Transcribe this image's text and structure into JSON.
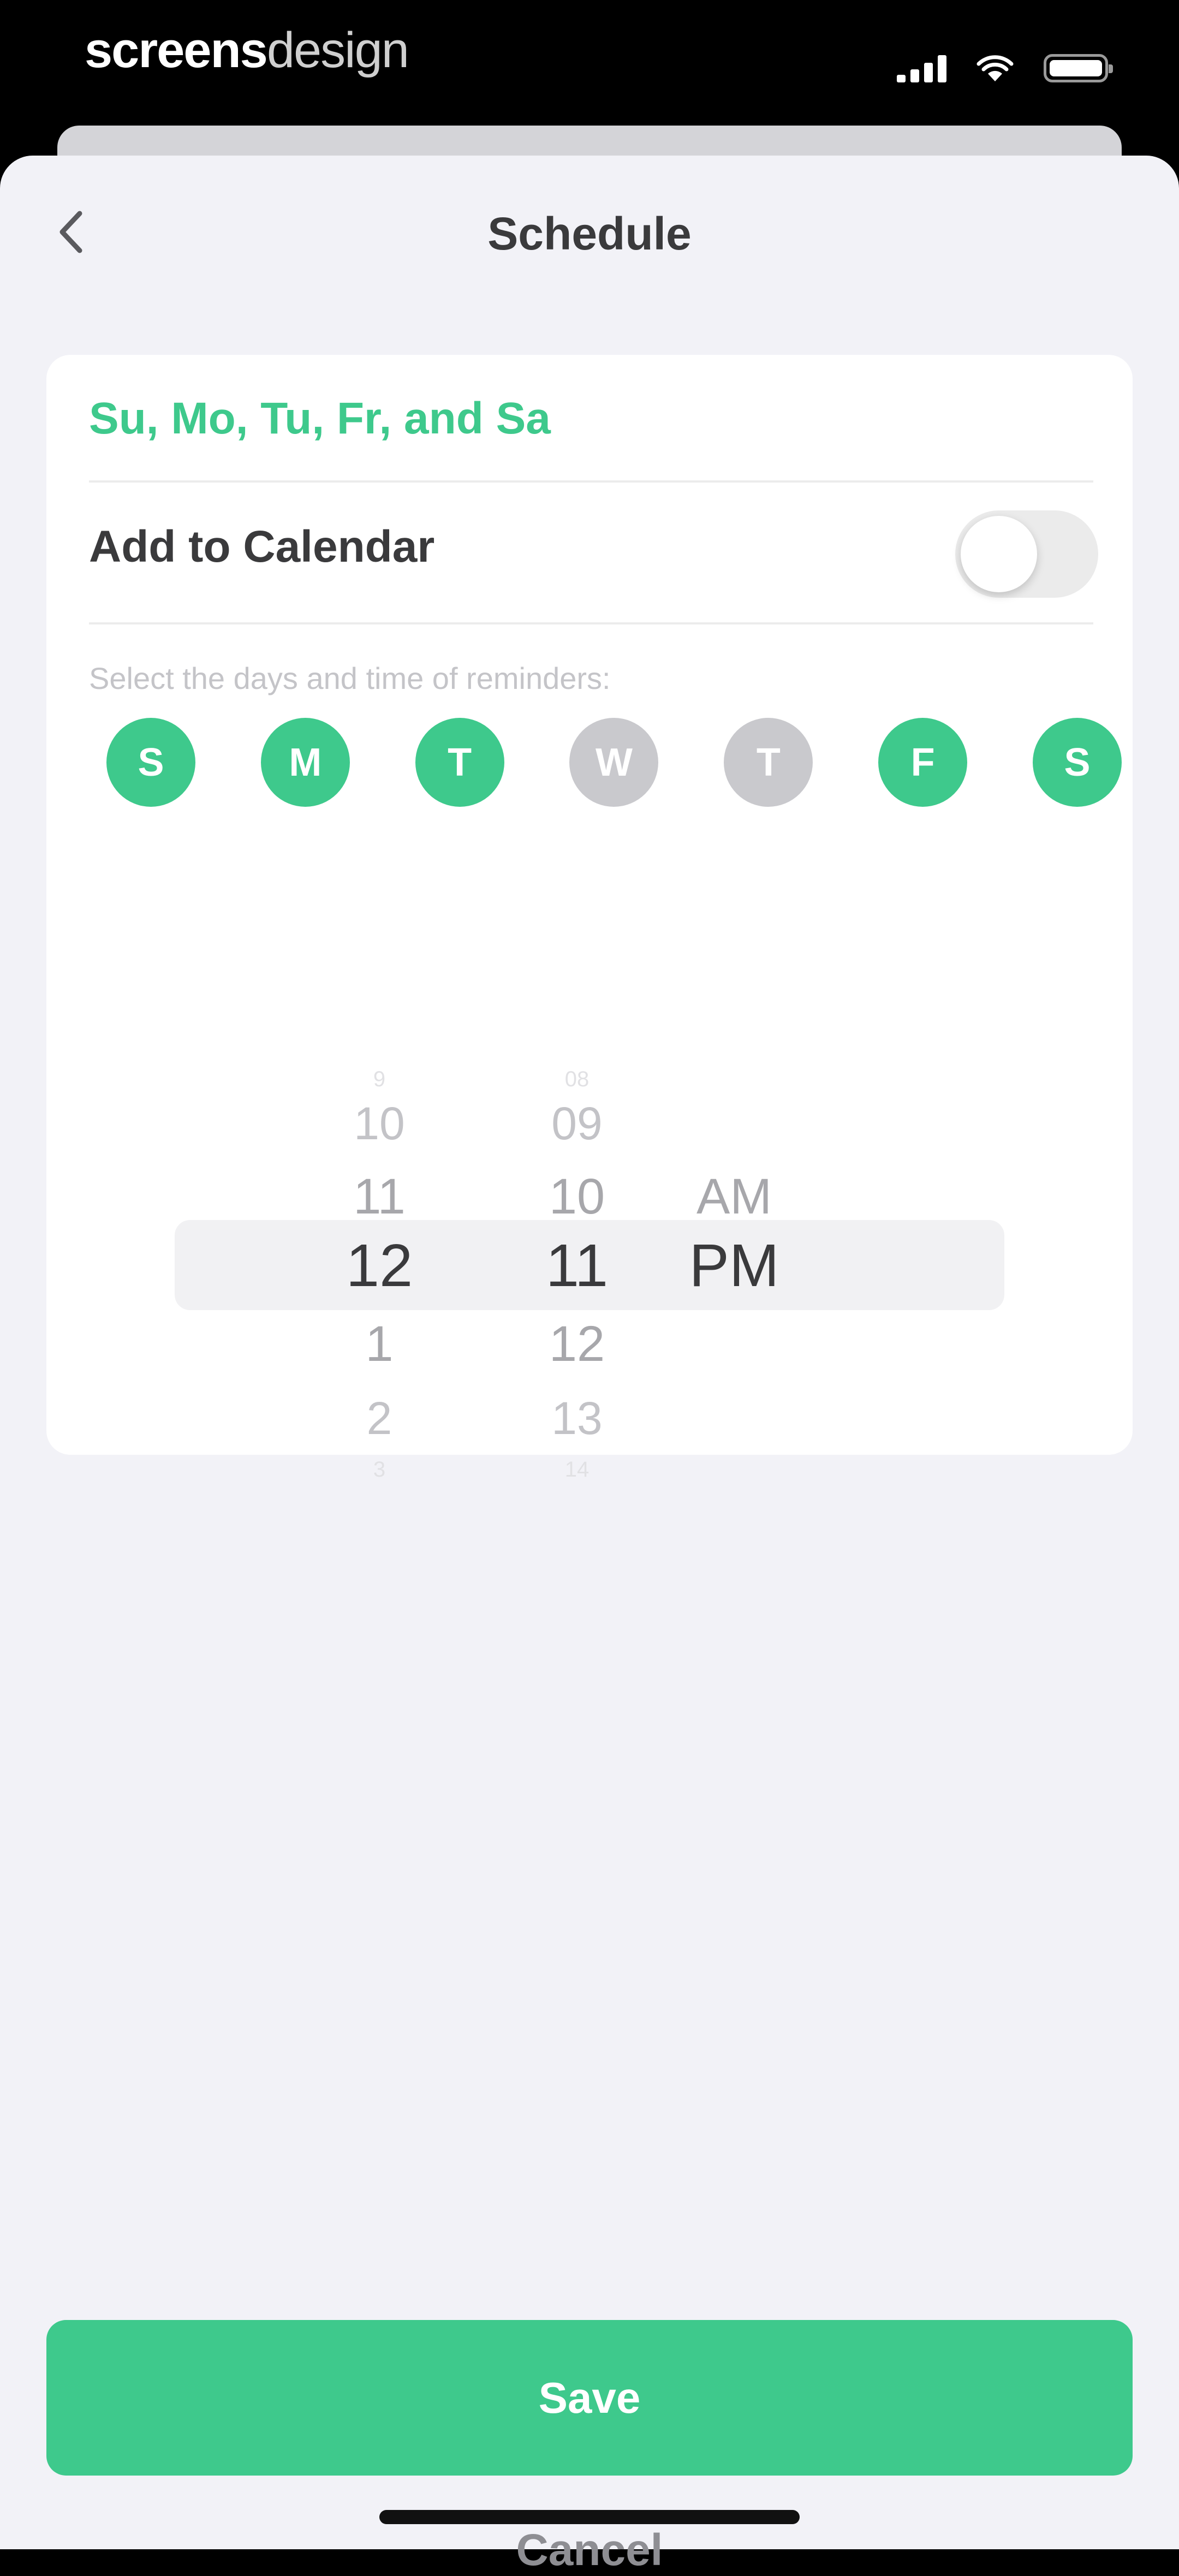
{
  "status_bar": {
    "brand_bold": "screens",
    "brand_light": "design"
  },
  "header": {
    "title": "Schedule"
  },
  "schedule": {
    "days_summary": "Su, Mo, Tu, Fr, and Sa",
    "add_to_calendar_label": "Add to Calendar",
    "add_to_calendar_enabled": false,
    "reminder_hint": "Select the days and time of reminders:",
    "days": [
      {
        "label": "S",
        "selected": true
      },
      {
        "label": "M",
        "selected": true
      },
      {
        "label": "T",
        "selected": true
      },
      {
        "label": "W",
        "selected": false
      },
      {
        "label": "T",
        "selected": false
      },
      {
        "label": "F",
        "selected": true
      },
      {
        "label": "S",
        "selected": true
      }
    ]
  },
  "time_picker": {
    "hours": [
      "9",
      "10",
      "11",
      "12",
      "1",
      "2",
      "3"
    ],
    "minutes": [
      "08",
      "09",
      "10",
      "11",
      "12",
      "13",
      "14"
    ],
    "periods": [
      "AM",
      "PM"
    ],
    "selected_hour": "12",
    "selected_minute": "11",
    "selected_period": "PM"
  },
  "actions": {
    "save_label": "Save",
    "cancel_label": "Cancel"
  },
  "colors": {
    "accent": "#3ec98c",
    "day_off": "#c9c9cd",
    "background": "#f2f2f7",
    "text": "#3a3a3c"
  }
}
